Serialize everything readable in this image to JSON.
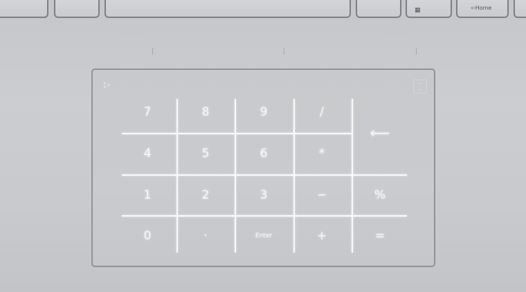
{
  "keyboard_row": {
    "keys": [
      {
        "name": "key-left-1",
        "label": ""
      },
      {
        "name": "key-left-2",
        "label": ""
      },
      {
        "name": "spacebar",
        "label": ""
      },
      {
        "name": "key-right-1",
        "label": ""
      },
      {
        "name": "key-right-2",
        "label": ""
      },
      {
        "name": "home-key",
        "label": "Home",
        "prefix": "⇦"
      },
      {
        "name": "key-right-4",
        "label": ""
      }
    ]
  },
  "touchpad": {
    "numpad_keys": [
      {
        "label": "7",
        "name": "numpad-key-7"
      },
      {
        "label": "8",
        "name": "numpad-key-8"
      },
      {
        "label": "9",
        "name": "numpad-key-9"
      },
      {
        "label": "/",
        "name": "numpad-key-divide"
      },
      {
        "label": "⟵",
        "name": "numpad-key-backspace"
      },
      {
        "label": "4",
        "name": "numpad-key-4"
      },
      {
        "label": "5",
        "name": "numpad-key-5"
      },
      {
        "label": "6",
        "name": "numpad-key-6"
      },
      {
        "label": "*",
        "name": "numpad-key-multiply"
      },
      {
        "label": "1",
        "name": "numpad-key-1"
      },
      {
        "label": "2",
        "name": "numpad-key-2"
      },
      {
        "label": "3",
        "name": "numpad-key-3"
      },
      {
        "label": "−",
        "name": "numpad-key-minus"
      },
      {
        "label": "%",
        "name": "numpad-key-percent"
      },
      {
        "label": "0",
        "name": "numpad-key-0"
      },
      {
        "label": "·",
        "name": "numpad-key-decimal"
      },
      {
        "label": "Enter",
        "name": "numpad-key-enter"
      },
      {
        "label": "+",
        "name": "numpad-key-plus"
      },
      {
        "label": "=",
        "name": "numpad-key-equals"
      }
    ],
    "icons": {
      "numpad_toggle": "numberpad-toggle-icon",
      "calculator": "calculator-icon"
    }
  },
  "colors": {
    "chassis": "#c8cacd",
    "key_border": "#7c7f84",
    "touchpad_border": "#8f9297",
    "numpad_glow": "#f4f6f8"
  }
}
